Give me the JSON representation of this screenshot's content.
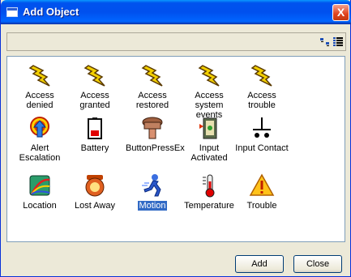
{
  "window": {
    "title": "Add Object",
    "close_glyph": "X"
  },
  "toolbar": {
    "buttons": [
      {
        "icon": "small-icons-view-icon"
      },
      {
        "icon": "list-view-icon"
      }
    ]
  },
  "items": [
    {
      "label": "Access denied",
      "icon": "lightning-bolt-icon",
      "selected": false
    },
    {
      "label": "Access granted",
      "icon": "lightning-bolt-icon",
      "selected": false
    },
    {
      "label": "Access restored",
      "icon": "lightning-bolt-icon",
      "selected": false
    },
    {
      "label": "Access system events",
      "icon": "lightning-bolt-icon",
      "selected": false
    },
    {
      "label": "Access trouble",
      "icon": "lightning-bolt-icon",
      "selected": false
    },
    {
      "label": "Alert Escalation",
      "icon": "alert-escalation-icon",
      "selected": false
    },
    {
      "label": "Battery",
      "icon": "battery-icon",
      "selected": false
    },
    {
      "label": "ButtonPressEx",
      "icon": "button-press-icon",
      "selected": false
    },
    {
      "label": "Input Activated",
      "icon": "input-activated-icon",
      "selected": false
    },
    {
      "label": "Input Contact",
      "icon": "input-contact-icon",
      "selected": false
    },
    {
      "label": "Location",
      "icon": "location-icon",
      "selected": false
    },
    {
      "label": "Lost Away",
      "icon": "lost-away-icon",
      "selected": false
    },
    {
      "label": "Motion",
      "icon": "motion-icon",
      "selected": true
    },
    {
      "label": "Temperature",
      "icon": "temperature-icon",
      "selected": false
    },
    {
      "label": "Trouble",
      "icon": "trouble-warning-icon",
      "selected": false
    }
  ],
  "buttons": {
    "add": "Add",
    "close": "Close"
  },
  "colors": {
    "title_bar": "#0054e3",
    "selection": "#316ac5",
    "close_button": "#e0421d",
    "dialog_face": "#ece9d8"
  }
}
